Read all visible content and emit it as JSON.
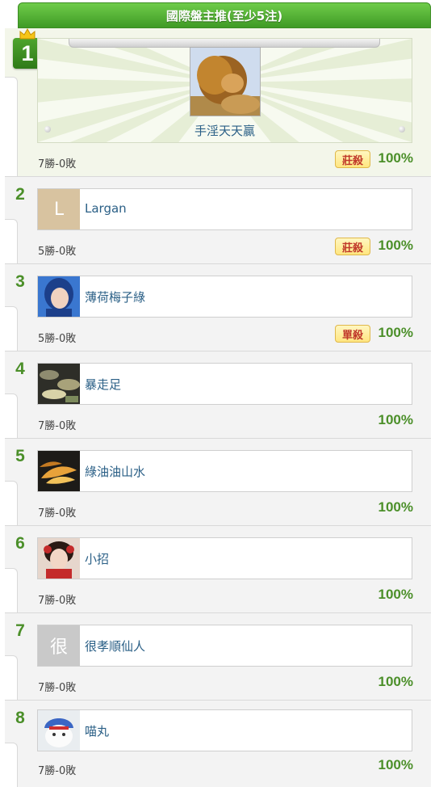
{
  "header": {
    "title": "國際盤主推(至少5注)"
  },
  "entries": [
    {
      "rank": "1",
      "name": "手淫天天贏",
      "record": "7勝-0敗",
      "badge": "莊殺",
      "pct": "100%",
      "avatar": "lion-photo"
    },
    {
      "rank": "2",
      "name": "Largan",
      "record": "5勝-0敗",
      "badge": "莊殺",
      "pct": "100%",
      "avatar_letter": "L",
      "avatar_color": "#d8c3a0"
    },
    {
      "rank": "3",
      "name": "薄荷梅子綠",
      "record": "5勝-0敗",
      "badge": "單殺",
      "pct": "100%",
      "avatar": "person-photo"
    },
    {
      "rank": "4",
      "name": "暴走足",
      "record": "7勝-0敗",
      "pct": "100%",
      "avatar": "money-photo"
    },
    {
      "rank": "5",
      "name": "綠油油山水",
      "record": "7勝-0敗",
      "pct": "100%",
      "avatar": "fish-photo"
    },
    {
      "rank": "6",
      "name": "小招",
      "record": "7勝-0敗",
      "pct": "100%",
      "avatar": "girl-photo"
    },
    {
      "rank": "7",
      "name": "很孝順仙人",
      "record": "7勝-0敗",
      "pct": "100%",
      "avatar_letter": "很",
      "avatar_color": "#c9c9c9"
    },
    {
      "rank": "8",
      "name": "喵丸",
      "record": "7勝-0敗",
      "pct": "100%",
      "avatar": "cat-photo"
    }
  ],
  "colors": {
    "accent_green": "#4b8f29",
    "header_green": "#4fae32",
    "badge_red": "#c0392b",
    "name_blue": "#2a5f86"
  }
}
